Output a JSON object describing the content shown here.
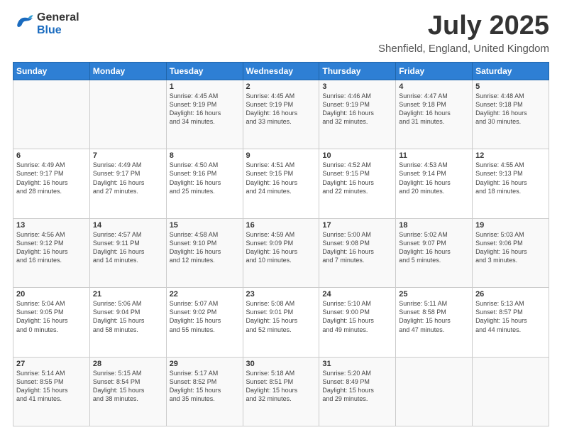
{
  "header": {
    "logo_line1": "General",
    "logo_line2": "Blue",
    "title": "July 2025",
    "subtitle": "Shenfield, England, United Kingdom"
  },
  "weekdays": [
    "Sunday",
    "Monday",
    "Tuesday",
    "Wednesday",
    "Thursday",
    "Friday",
    "Saturday"
  ],
  "weeks": [
    [
      {
        "day": "",
        "info": ""
      },
      {
        "day": "",
        "info": ""
      },
      {
        "day": "1",
        "info": "Sunrise: 4:45 AM\nSunset: 9:19 PM\nDaylight: 16 hours\nand 34 minutes."
      },
      {
        "day": "2",
        "info": "Sunrise: 4:45 AM\nSunset: 9:19 PM\nDaylight: 16 hours\nand 33 minutes."
      },
      {
        "day": "3",
        "info": "Sunrise: 4:46 AM\nSunset: 9:19 PM\nDaylight: 16 hours\nand 32 minutes."
      },
      {
        "day": "4",
        "info": "Sunrise: 4:47 AM\nSunset: 9:18 PM\nDaylight: 16 hours\nand 31 minutes."
      },
      {
        "day": "5",
        "info": "Sunrise: 4:48 AM\nSunset: 9:18 PM\nDaylight: 16 hours\nand 30 minutes."
      }
    ],
    [
      {
        "day": "6",
        "info": "Sunrise: 4:49 AM\nSunset: 9:17 PM\nDaylight: 16 hours\nand 28 minutes."
      },
      {
        "day": "7",
        "info": "Sunrise: 4:49 AM\nSunset: 9:17 PM\nDaylight: 16 hours\nand 27 minutes."
      },
      {
        "day": "8",
        "info": "Sunrise: 4:50 AM\nSunset: 9:16 PM\nDaylight: 16 hours\nand 25 minutes."
      },
      {
        "day": "9",
        "info": "Sunrise: 4:51 AM\nSunset: 9:15 PM\nDaylight: 16 hours\nand 24 minutes."
      },
      {
        "day": "10",
        "info": "Sunrise: 4:52 AM\nSunset: 9:15 PM\nDaylight: 16 hours\nand 22 minutes."
      },
      {
        "day": "11",
        "info": "Sunrise: 4:53 AM\nSunset: 9:14 PM\nDaylight: 16 hours\nand 20 minutes."
      },
      {
        "day": "12",
        "info": "Sunrise: 4:55 AM\nSunset: 9:13 PM\nDaylight: 16 hours\nand 18 minutes."
      }
    ],
    [
      {
        "day": "13",
        "info": "Sunrise: 4:56 AM\nSunset: 9:12 PM\nDaylight: 16 hours\nand 16 minutes."
      },
      {
        "day": "14",
        "info": "Sunrise: 4:57 AM\nSunset: 9:11 PM\nDaylight: 16 hours\nand 14 minutes."
      },
      {
        "day": "15",
        "info": "Sunrise: 4:58 AM\nSunset: 9:10 PM\nDaylight: 16 hours\nand 12 minutes."
      },
      {
        "day": "16",
        "info": "Sunrise: 4:59 AM\nSunset: 9:09 PM\nDaylight: 16 hours\nand 10 minutes."
      },
      {
        "day": "17",
        "info": "Sunrise: 5:00 AM\nSunset: 9:08 PM\nDaylight: 16 hours\nand 7 minutes."
      },
      {
        "day": "18",
        "info": "Sunrise: 5:02 AM\nSunset: 9:07 PM\nDaylight: 16 hours\nand 5 minutes."
      },
      {
        "day": "19",
        "info": "Sunrise: 5:03 AM\nSunset: 9:06 PM\nDaylight: 16 hours\nand 3 minutes."
      }
    ],
    [
      {
        "day": "20",
        "info": "Sunrise: 5:04 AM\nSunset: 9:05 PM\nDaylight: 16 hours\nand 0 minutes."
      },
      {
        "day": "21",
        "info": "Sunrise: 5:06 AM\nSunset: 9:04 PM\nDaylight: 15 hours\nand 58 minutes."
      },
      {
        "day": "22",
        "info": "Sunrise: 5:07 AM\nSunset: 9:02 PM\nDaylight: 15 hours\nand 55 minutes."
      },
      {
        "day": "23",
        "info": "Sunrise: 5:08 AM\nSunset: 9:01 PM\nDaylight: 15 hours\nand 52 minutes."
      },
      {
        "day": "24",
        "info": "Sunrise: 5:10 AM\nSunset: 9:00 PM\nDaylight: 15 hours\nand 49 minutes."
      },
      {
        "day": "25",
        "info": "Sunrise: 5:11 AM\nSunset: 8:58 PM\nDaylight: 15 hours\nand 47 minutes."
      },
      {
        "day": "26",
        "info": "Sunrise: 5:13 AM\nSunset: 8:57 PM\nDaylight: 15 hours\nand 44 minutes."
      }
    ],
    [
      {
        "day": "27",
        "info": "Sunrise: 5:14 AM\nSunset: 8:55 PM\nDaylight: 15 hours\nand 41 minutes."
      },
      {
        "day": "28",
        "info": "Sunrise: 5:15 AM\nSunset: 8:54 PM\nDaylight: 15 hours\nand 38 minutes."
      },
      {
        "day": "29",
        "info": "Sunrise: 5:17 AM\nSunset: 8:52 PM\nDaylight: 15 hours\nand 35 minutes."
      },
      {
        "day": "30",
        "info": "Sunrise: 5:18 AM\nSunset: 8:51 PM\nDaylight: 15 hours\nand 32 minutes."
      },
      {
        "day": "31",
        "info": "Sunrise: 5:20 AM\nSunset: 8:49 PM\nDaylight: 15 hours\nand 29 minutes."
      },
      {
        "day": "",
        "info": ""
      },
      {
        "day": "",
        "info": ""
      }
    ]
  ]
}
